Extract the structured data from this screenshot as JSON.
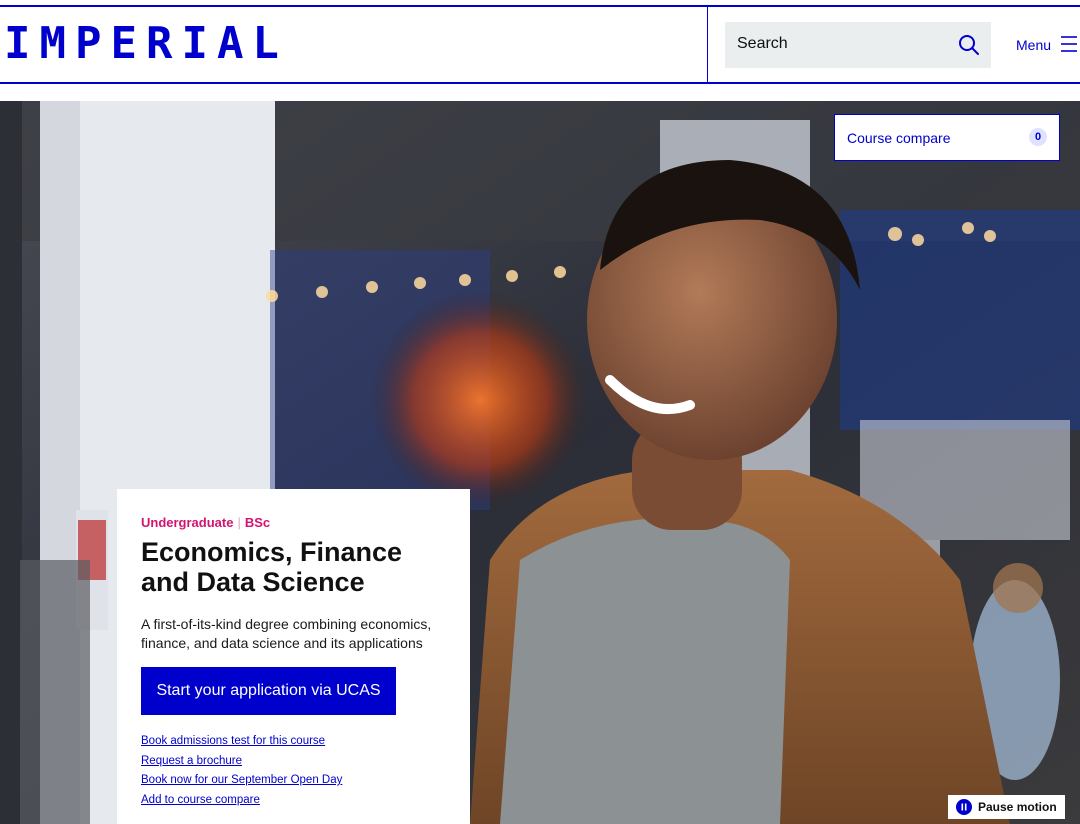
{
  "header": {
    "logo": "IMPERIAL",
    "search": {
      "placeholder": "Search",
      "icon": "search-icon"
    },
    "menu": {
      "label": "Menu",
      "icon": "hamburger-icon"
    }
  },
  "course_compare": {
    "label": "Course compare",
    "count": "0"
  },
  "hero": {
    "level": "Undergraduate",
    "degree": "BSc",
    "title": "Economics, Finance and Data Science",
    "description": "A first-of-its-kind degree combining economics, finance, and data science and its applications",
    "cta_label": "Start your application via UCAS",
    "links": [
      "Book admissions test for this course",
      "Request a brochure",
      "Book now for our September Open Day",
      "Add to course compare"
    ]
  },
  "pause_motion": {
    "label": "Pause motion",
    "icon": "pause-icon"
  },
  "colors": {
    "brand": "#0000cd",
    "accent": "#d4136f"
  }
}
